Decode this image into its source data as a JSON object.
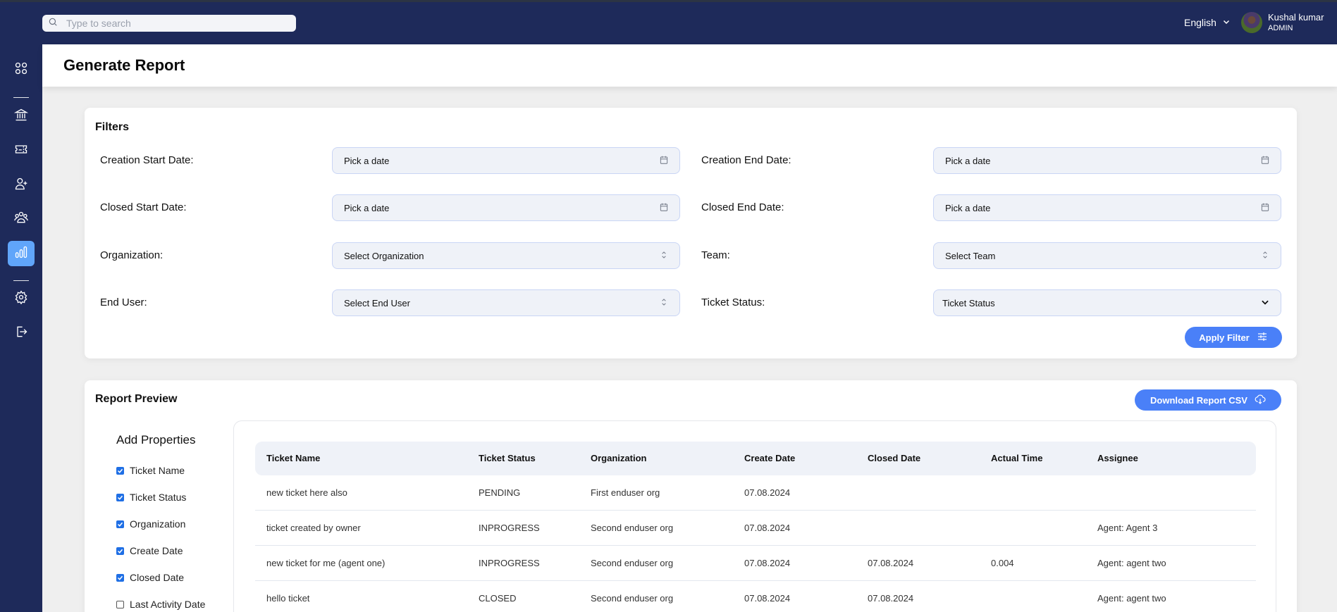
{
  "topbar": {
    "search_placeholder": "Type to search",
    "language": "English",
    "user": {
      "name": "Kushal kumar",
      "role": "ADMIN"
    }
  },
  "sidebar": {
    "items": [
      {
        "icon": "dashboard-grid-icon",
        "active": false
      },
      {
        "icon": "bank-icon",
        "active": false
      },
      {
        "icon": "ticket-icon",
        "active": false
      },
      {
        "icon": "add-user-icon",
        "active": false
      },
      {
        "icon": "team-icon",
        "active": false
      },
      {
        "icon": "reports-chart-icon",
        "active": true
      },
      {
        "icon": "settings-gear-icon",
        "active": false
      },
      {
        "icon": "logout-icon",
        "active": false
      }
    ]
  },
  "page": {
    "title": "Generate Report"
  },
  "filters": {
    "title": "Filters",
    "creation_start_label": "Creation Start Date:",
    "creation_start_placeholder": "Pick a date",
    "creation_end_label": "Creation End Date:",
    "creation_end_placeholder": "Pick a date",
    "closed_start_label": "Closed Start Date:",
    "closed_start_placeholder": "Pick a date",
    "closed_end_label": "Closed End Date:",
    "closed_end_placeholder": "Pick a date",
    "organization_label": "Organization:",
    "organization_value": "Select Organization",
    "team_label": "Team:",
    "team_value": "Select Team",
    "end_user_label": "End User:",
    "end_user_value": "Select End User",
    "ticket_status_label": "Ticket Status:",
    "ticket_status_value": "Ticket Status",
    "apply_label": "Apply Filter"
  },
  "report": {
    "title": "Report Preview",
    "download_label": "Download Report CSV",
    "properties_title": "Add Properties",
    "properties": [
      {
        "label": "Ticket Name",
        "checked": true
      },
      {
        "label": "Ticket Status",
        "checked": true
      },
      {
        "label": "Organization",
        "checked": true
      },
      {
        "label": "Create Date",
        "checked": true
      },
      {
        "label": "Closed Date",
        "checked": true
      },
      {
        "label": "Last Activity Date",
        "checked": false
      }
    ],
    "columns": [
      "Ticket Name",
      "Ticket Status",
      "Organization",
      "Create Date",
      "Closed Date",
      "Actual Time",
      "Assignee"
    ],
    "rows": [
      [
        "new ticket here also",
        "PENDING",
        "First enduser org",
        "07.08.2024",
        "",
        "",
        ""
      ],
      [
        "ticket created by owner",
        "INPROGRESS",
        "Second enduser org",
        "07.08.2024",
        "",
        "",
        "Agent: Agent 3"
      ],
      [
        "new ticket for me (agent one)",
        "INPROGRESS",
        "Second enduser org",
        "07.08.2024",
        "07.08.2024",
        "0.004",
        "Agent: agent two"
      ],
      [
        "hello ticket",
        "CLOSED",
        "Second enduser org",
        "07.08.2024",
        "07.08.2024",
        "",
        "Agent: agent two"
      ]
    ]
  },
  "colors": {
    "navy": "#1e2a5a",
    "accent": "#4a80f8",
    "active_nav": "#60a5fa",
    "field_bg": "#eff2f8"
  }
}
